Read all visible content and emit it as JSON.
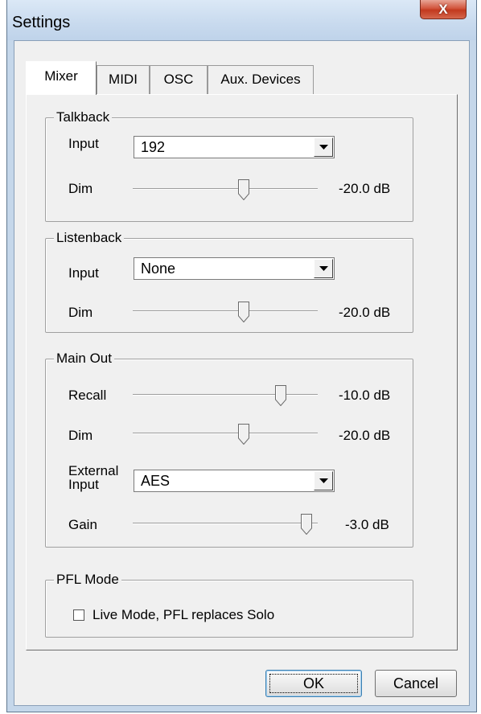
{
  "window": {
    "title": "Settings",
    "close_glyph": "X"
  },
  "tabs": [
    {
      "label": "Mixer",
      "active": true
    },
    {
      "label": "MIDI",
      "active": false
    },
    {
      "label": "OSC",
      "active": false
    },
    {
      "label": "Aux. Devices",
      "active": false
    }
  ],
  "talkback": {
    "legend": "Talkback",
    "input_label": "Input",
    "input_value": "192",
    "dim_label": "Dim",
    "dim_value": "-20.0 dB",
    "dim_slider_fraction": 0.6
  },
  "listenback": {
    "legend": "Listenback",
    "input_label": "Input",
    "input_value": "None",
    "dim_label": "Dim",
    "dim_value": "-20.0 dB",
    "dim_slider_fraction": 0.6
  },
  "main_out": {
    "legend": "Main Out",
    "recall_label": "Recall",
    "recall_value": "-10.0 dB",
    "recall_slider_fraction": 0.8,
    "dim_label": "Dim",
    "dim_value": "-20.0 dB",
    "dim_slider_fraction": 0.6,
    "external_input_label_line1": "External",
    "external_input_label_line2": "Input",
    "external_input_value": "AES",
    "gain_label": "Gain",
    "gain_value": "-3.0 dB",
    "gain_slider_fraction": 0.94
  },
  "pfl_mode": {
    "legend": "PFL Mode",
    "checkbox_label": "Live Mode,  PFL replaces Solo",
    "checked": false
  },
  "buttons": {
    "ok": "OK",
    "cancel": "Cancel"
  },
  "icons": {
    "close": "close-icon",
    "dropdown": "chevron-down-icon"
  }
}
